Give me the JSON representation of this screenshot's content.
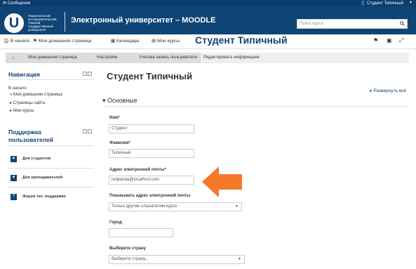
{
  "topbar": {
    "messages": "Сообщения",
    "user": "Студент Типичный"
  },
  "header": {
    "logo_letter": "U",
    "logo_caption": "Национальный исследовательский Томский государственный университет",
    "site_title": "Электронный университет – MOODLE",
    "search_placeholder": "Поиск курса"
  },
  "navbar": {
    "items": [
      "В начало",
      "Моя домашняя страница",
      "Календарь",
      "Мои курсы"
    ],
    "big_title": "Студент Типичный"
  },
  "breadcrumb": [
    "Моя домашняя страница",
    "Настройки",
    "Учетная запись пользователя",
    "Редактировать информацию"
  ],
  "sidebar": {
    "nav_title": "Навигация",
    "nav_root": "В начало",
    "nav_items": [
      "Моя домашняя страница",
      "Страницы сайта",
      "Мои курсы"
    ],
    "support_title": "Поддержка пользователей",
    "support_items": [
      "Для студентов",
      "Для преподавателей",
      "Форум тех. поддержки"
    ]
  },
  "main": {
    "title": "Студент Типичный",
    "expand_all": "Развернуть всё",
    "section": "Основные",
    "fields": {
      "firstname_label": "Имя",
      "firstname_value": "Студент",
      "lastname_label": "Фамилия",
      "lastname_value": "Типичный",
      "email_label": "Адрес электронной почты",
      "email_value": "redpanda@localhost.com",
      "showemail_label": "Показывать адрес электронной почты",
      "showemail_value": "Только другим слушателям курса",
      "city_label": "Город",
      "city_value": "",
      "country_label": "Выберите страну",
      "country_value": "Выберите страну..."
    }
  },
  "colors": {
    "brand": "#0e4476",
    "arrow": "#f47a2a",
    "required": "#cc0000"
  }
}
